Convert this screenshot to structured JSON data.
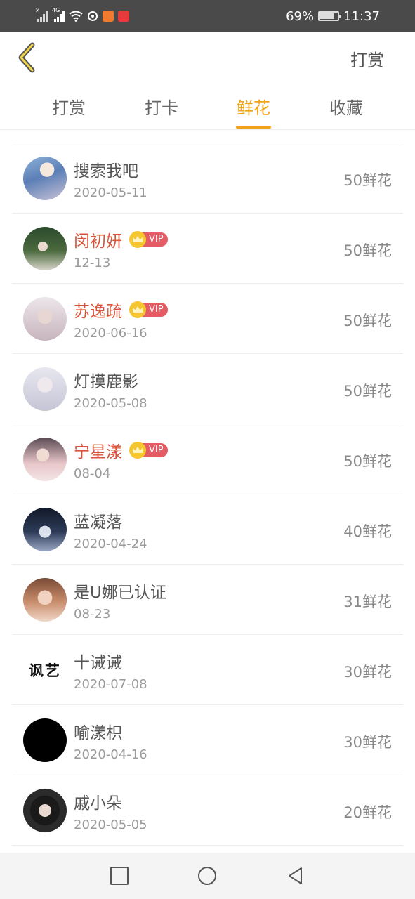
{
  "status_bar": {
    "battery": "69%",
    "time": "11:37",
    "network": "4G",
    "colors": {
      "bg": "#4a4a4a",
      "text": "#ffffff"
    },
    "icons": [
      "signal-icon",
      "signal-4g-icon",
      "wifi-icon",
      "sync-icon",
      "video-app-icon",
      "app-badge-icon",
      "battery-icon"
    ]
  },
  "header": {
    "back_icon": "chevron-left-icon",
    "right_label": "打赏"
  },
  "tabs": [
    {
      "label": "打赏",
      "active": false
    },
    {
      "label": "打卡",
      "active": false
    },
    {
      "label": "鲜花",
      "active": true
    },
    {
      "label": "收藏",
      "active": false
    }
  ],
  "accent_color": "#f0a21a",
  "vip_name_color": "#d9533a",
  "vip_badge_label": "VIP",
  "list": [
    {
      "name": "搜索我吧",
      "date": "2020-05-11",
      "amount": "50鲜花",
      "vip": false
    },
    {
      "name": "闵初妍",
      "date": "12-13",
      "amount": "50鲜花",
      "vip": true
    },
    {
      "name": "苏逸疏",
      "date": "2020-06-16",
      "amount": "50鲜花",
      "vip": true
    },
    {
      "name": "灯摸鹿影",
      "date": "2020-05-08",
      "amount": "50鲜花",
      "vip": false
    },
    {
      "name": "宁星漾",
      "date": "08-04",
      "amount": "50鲜花",
      "vip": true
    },
    {
      "name": "蓝凝落",
      "date": "2020-04-24",
      "amount": "40鲜花",
      "vip": false
    },
    {
      "name": "是U娜已认证",
      "date": "08-23",
      "amount": "31鲜花",
      "vip": false
    },
    {
      "name": "十诫诫",
      "date": "2020-07-08",
      "amount": "30鲜花",
      "vip": false,
      "avatar_text": "讽艺"
    },
    {
      "name": "喻漾枳",
      "date": "2020-04-16",
      "amount": "30鲜花",
      "vip": false
    },
    {
      "name": "戚小朵",
      "date": "2020-05-05",
      "amount": "20鲜花",
      "vip": false
    }
  ],
  "nav_bar": {
    "buttons": [
      "recent-apps-icon",
      "home-icon",
      "back-triangle-icon"
    ]
  }
}
